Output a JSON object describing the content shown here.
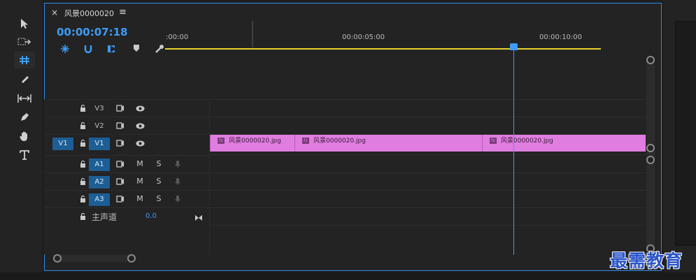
{
  "sequence": {
    "tab_title": "风景0000020",
    "close_glyph": "×",
    "menu_glyph": "≡",
    "timecode": "00:00:07:18"
  },
  "ruler": {
    "labels": [
      ":00:00",
      "00:00:05:00",
      "00:00:10:00"
    ]
  },
  "tools": [
    "selection-tool",
    "track-select-tool",
    "ripple-edit-tool",
    "razor-tool",
    "slip-tool",
    "pen-tool",
    "hand-tool",
    "type-tool"
  ],
  "toolbar": [
    "snap-icon",
    "linked-selection-icon",
    "add-marker-icon",
    "marker-icon",
    "wrench-icon"
  ],
  "tracks": [
    {
      "id": "V3",
      "target": "",
      "kind": "video"
    },
    {
      "id": "V2",
      "target": "",
      "kind": "video"
    },
    {
      "id": "V1",
      "target": "V1",
      "kind": "video"
    },
    {
      "id": "A1",
      "target": "",
      "kind": "audio",
      "m": "M",
      "s": "S"
    },
    {
      "id": "A2",
      "target": "",
      "kind": "audio",
      "m": "M",
      "s": "S"
    },
    {
      "id": "A3",
      "target": "",
      "kind": "audio",
      "m": "M",
      "s": "S"
    }
  ],
  "master": {
    "label": "主声道",
    "value": "0.0"
  },
  "clips": [
    {
      "name": "风景0000020.jpg"
    },
    {
      "name": "风景0000020.jpg"
    },
    {
      "name": "风景0000020.jpg"
    }
  ],
  "watermark": "最需教育",
  "colors": {
    "accent": "#3d9cf5",
    "clip": "#e07de0",
    "work_area": "#e6d22d"
  }
}
